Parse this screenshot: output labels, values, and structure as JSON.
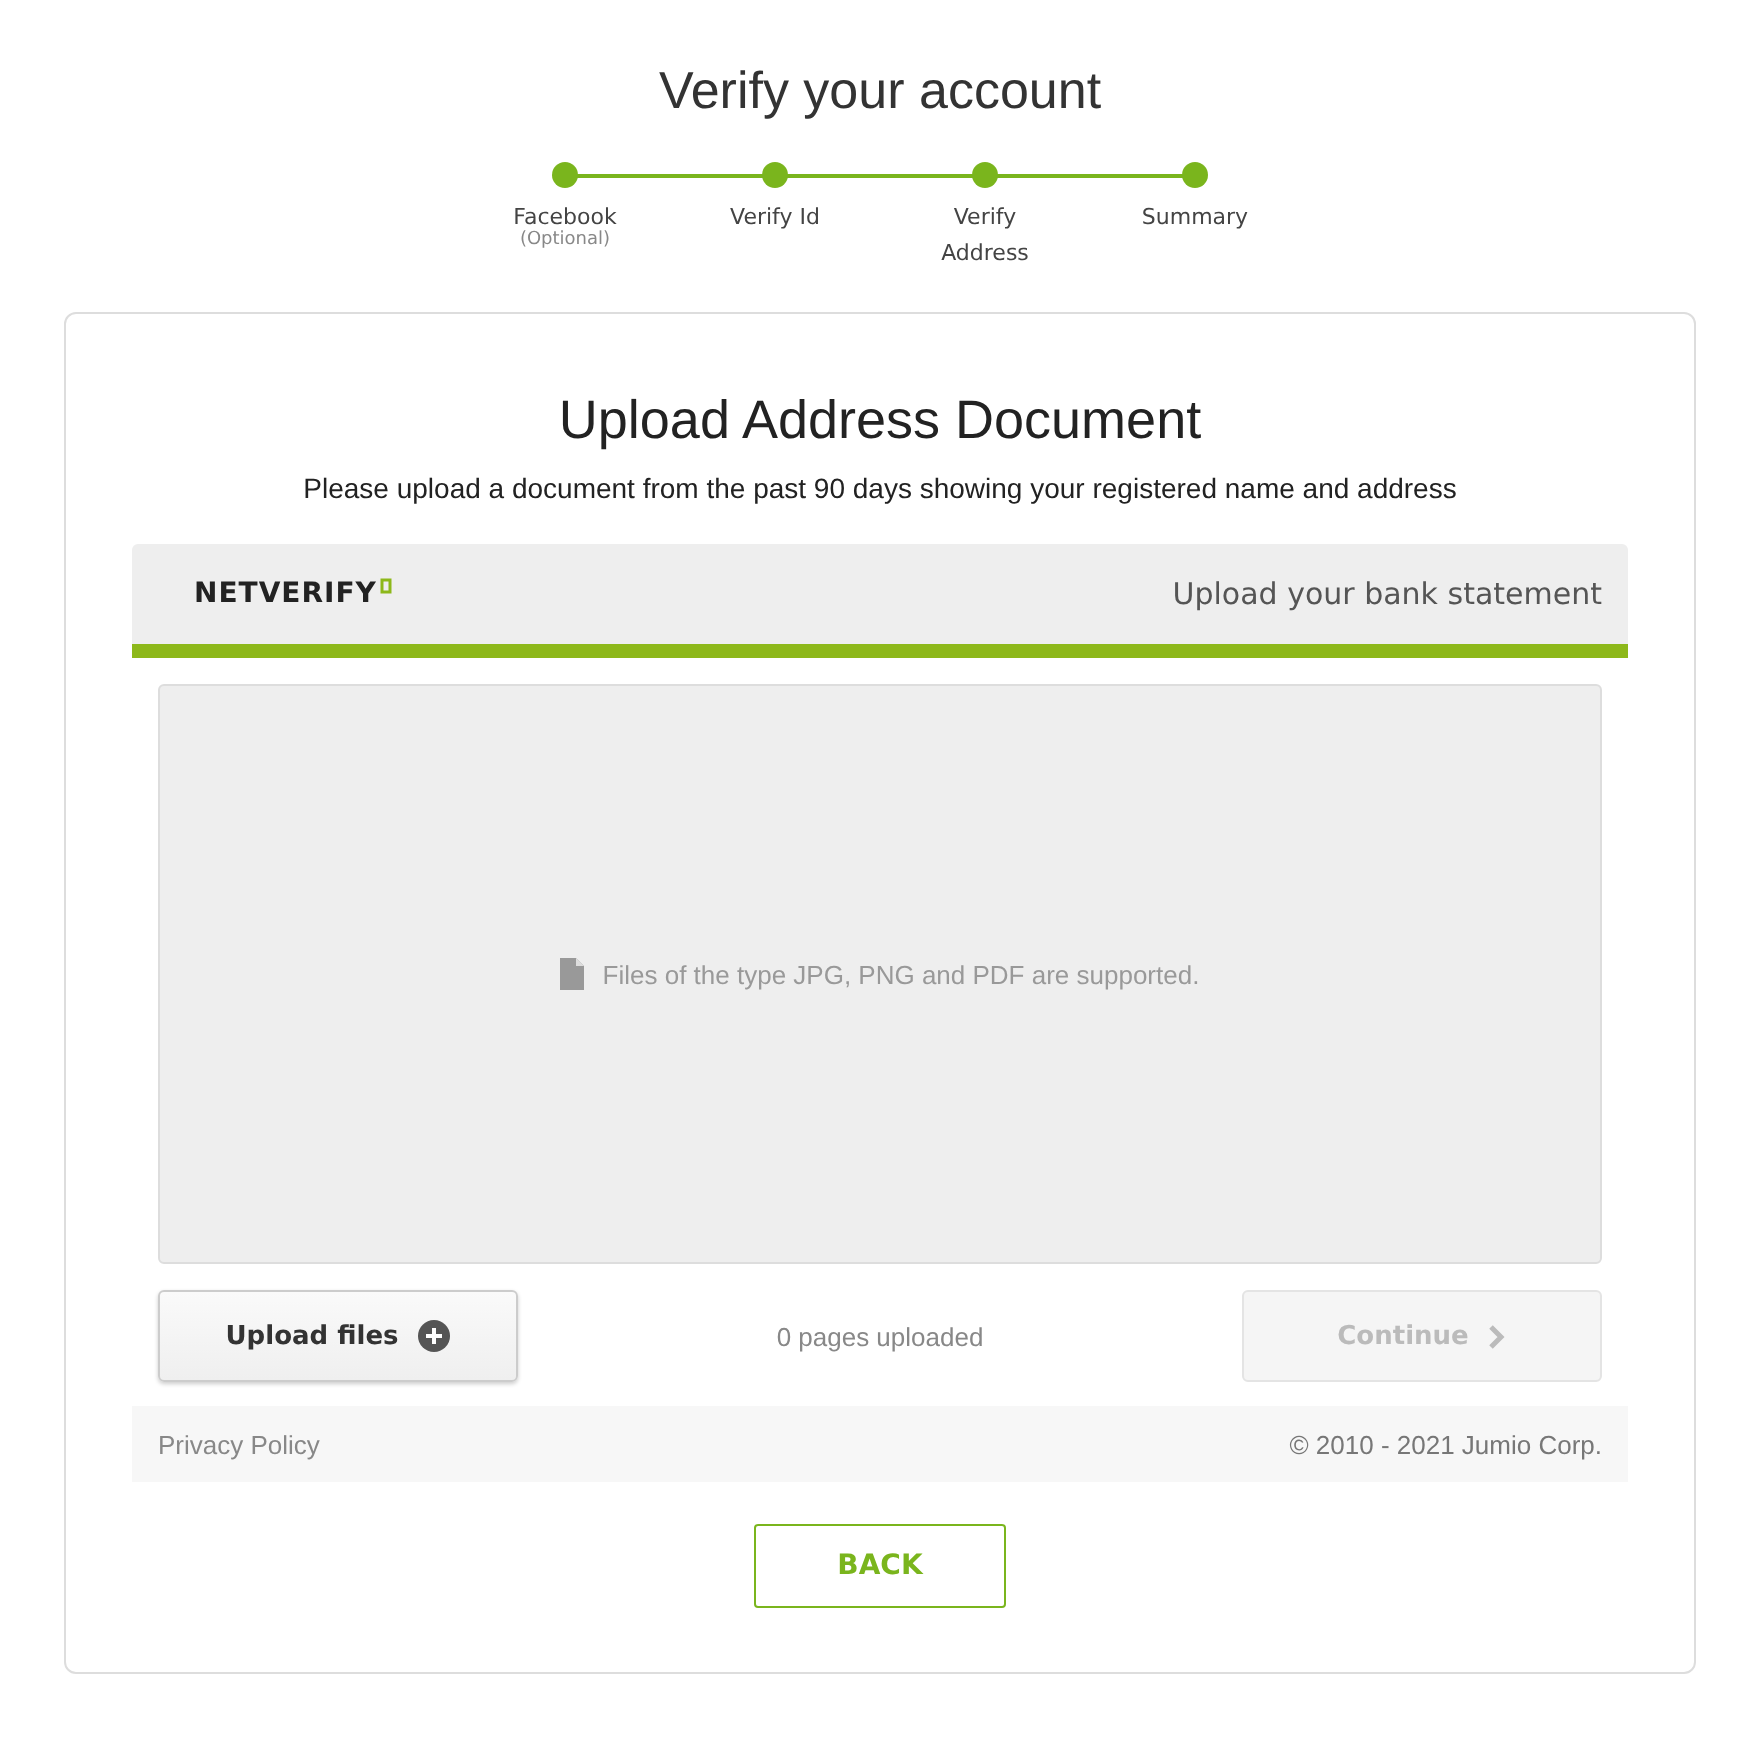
{
  "page_title": "Verify your account",
  "steps": [
    {
      "label": "Facebook",
      "note": "(Optional)"
    },
    {
      "label": "Verify Id"
    },
    {
      "label": "Verify Address"
    },
    {
      "label": "Summary"
    }
  ],
  "card": {
    "title": "Upload Address Document",
    "subtitle": "Please upload a document from the past 90 days showing your registered name and address"
  },
  "widget": {
    "logo": "NETVERIFY",
    "header_text": "Upload your bank statement",
    "drop_hint": "Files of the type JPG, PNG and PDF are supported.",
    "upload_button": "Upload files",
    "pages_count": "0 pages uploaded",
    "continue_button": {
      "label": "Continue",
      "disabled": true
    },
    "privacy_link": "Privacy Policy",
    "copyright": "© 2010 - 2021 Jumio Corp."
  },
  "back_button": "BACK"
}
